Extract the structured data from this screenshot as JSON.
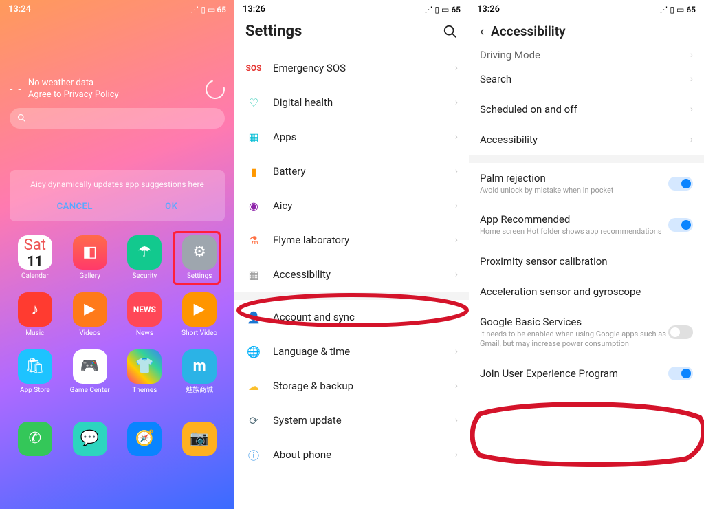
{
  "panel1": {
    "time": "13:24",
    "battery": "65",
    "weather_line1": "No weather data",
    "weather_line2": "Agree to Privacy Policy",
    "aicy_msg": "Aicy dynamically updates app suggestions here",
    "cancel": "CANCEL",
    "ok": "OK",
    "cal_day": "Sat",
    "cal_num": "11",
    "apps": [
      {
        "label": "Calendar"
      },
      {
        "label": "Gallery"
      },
      {
        "label": "Security"
      },
      {
        "label": "Settings"
      },
      {
        "label": "Music"
      },
      {
        "label": "Videos"
      },
      {
        "label": "News"
      },
      {
        "label": "Short Video"
      },
      {
        "label": "App Store"
      },
      {
        "label": "Game Center"
      },
      {
        "label": "Themes"
      },
      {
        "label": "魅族商城"
      }
    ],
    "dock": [
      {
        "name": "phone"
      },
      {
        "name": "messages"
      },
      {
        "name": "browser"
      },
      {
        "name": "camera"
      }
    ]
  },
  "panel2": {
    "time": "13:26",
    "battery": "65",
    "title": "Settings",
    "items": [
      {
        "label": "Emergency SOS"
      },
      {
        "label": "Digital health"
      },
      {
        "label": "Apps"
      },
      {
        "label": "Battery"
      },
      {
        "label": "Aicy"
      },
      {
        "label": "Flyme laboratory"
      },
      {
        "label": "Accessibility"
      },
      {
        "label": "Account and sync"
      },
      {
        "label": "Language & time"
      },
      {
        "label": "Storage & backup"
      },
      {
        "label": "System update"
      },
      {
        "label": "About phone"
      }
    ]
  },
  "panel3": {
    "time": "13:26",
    "battery": "65",
    "title": "Accessibility",
    "itemsA": [
      {
        "label": "Driving Mode"
      },
      {
        "label": "Search"
      },
      {
        "label": "Scheduled on and off"
      },
      {
        "label": "Accessibility"
      }
    ],
    "itemsB": [
      {
        "label": "Palm rejection",
        "sub": "Avoid unlock by mistake when in pocket",
        "toggle": true,
        "on": true
      },
      {
        "label": "App Recommended",
        "sub": "Home screen Hot folder shows app recommendations",
        "toggle": true,
        "on": true
      },
      {
        "label": "Proximity sensor calibration"
      },
      {
        "label": "Acceleration sensor and gyroscope"
      },
      {
        "label": "Google Basic Services",
        "sub": "It needs to be enabled when using Google apps such as Gmail, but may increase power consumption",
        "toggle": true,
        "on": false
      },
      {
        "label": "Join User Experience Program",
        "toggle": true,
        "on": true
      }
    ]
  }
}
